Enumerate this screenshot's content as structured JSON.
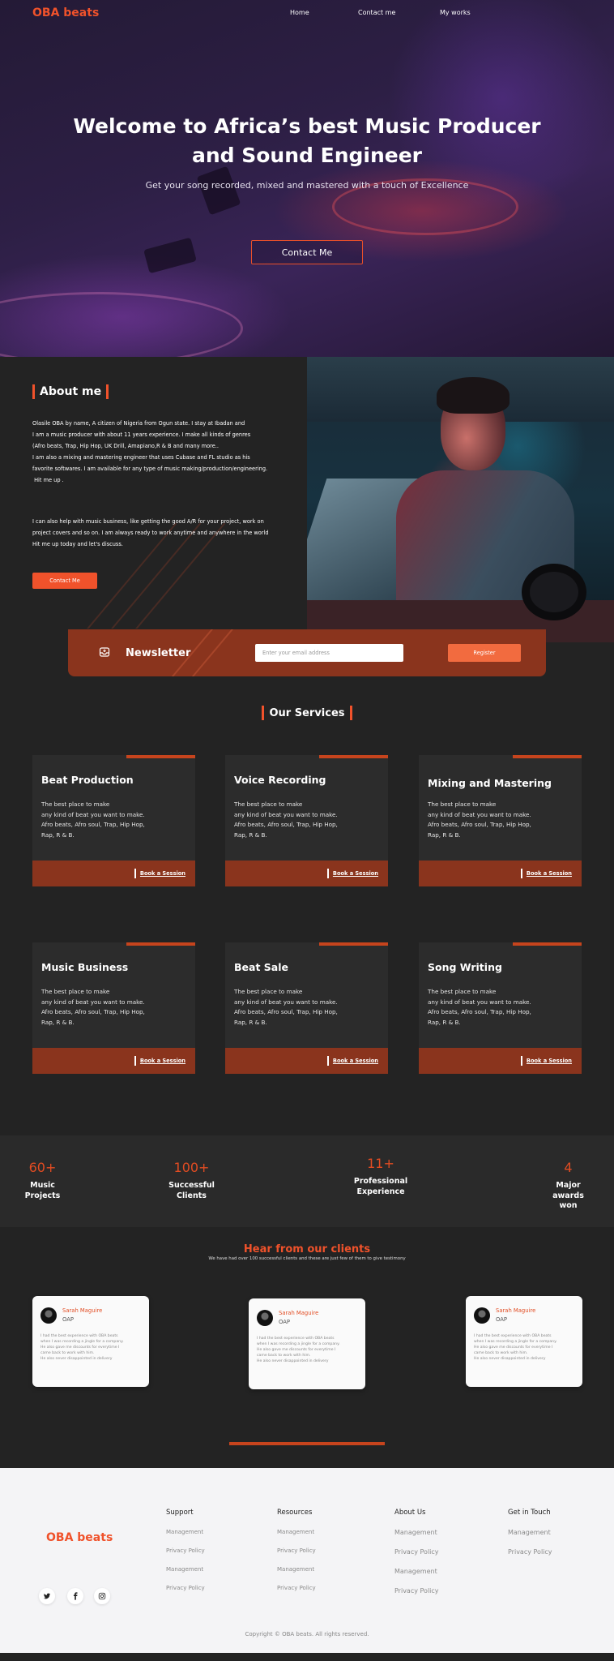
{
  "nav": {
    "logo": "OBA beats",
    "links": [
      "Home",
      "Contact me",
      "My works"
    ]
  },
  "hero": {
    "title_line1": "Welcome to Africa’s best Music Producer",
    "title_line2": "and Sound Engineer",
    "subtitle": "Get your song recorded, mixed and mastered with a touch of Excellence",
    "button": "Contact Me"
  },
  "about": {
    "heading": "About me",
    "para1": [
      "Olasile OBA by name, A citizen of Nigeria from Ogun state. I stay at Ibadan and",
      "I am a music producer with about 11 years experience. I make all kinds of genres",
      "(Afro beats, Trap, Hip Hop, UK Drill, Amapiano,R & B and many more..",
      "I am also a mixing and mastering engineer that uses Cubase and FL studio as his",
      "favorite softwares. I am available for  any type of music making/production/engineering.",
      " Hit me up ."
    ],
    "para2": [
      "I can also help with music business, like getting the good A/R for your project, work on",
      "project covers and so on. I am always ready to work anytime and anywhere in the world",
      "Hit me up today and let's discuss."
    ],
    "button": "Contact Me"
  },
  "newsletter": {
    "title": "Newsletter",
    "email_placeholder": "Enter your email address",
    "email_value": "",
    "button": "Register",
    "icon": "inbox-icon"
  },
  "services": {
    "heading": "Our Services",
    "items": [
      {
        "title": "Beat Production",
        "text": "The best place to make\nany kind of beat you want to make.\nAfro beats, Afro soul, Trap, Hip Hop,\nRap, R & B.",
        "link": "Book a Session"
      },
      {
        "title": "Voice Recording",
        "text": "The best place to make\nany kind of beat you want to make.\nAfro beats, Afro soul, Trap, Hip Hop,\nRap, R & B.",
        "link": "Book a Session"
      },
      {
        "title": "Mixing and Mastering",
        "text": "The best place to make\nany kind of beat you want to make.\nAfro beats, Afro soul, Trap, Hip Hop,\nRap, R & B.",
        "link": "Book a Session"
      },
      {
        "title": "Music Business",
        "text": "The best place to make\nany kind of beat you want to make.\nAfro beats, Afro soul, Trap, Hip Hop,\nRap, R & B.",
        "link": "Book a Session"
      },
      {
        "title": "Beat Sale",
        "text": "The best place to make\nany kind of beat you want to make.\nAfro beats, Afro soul, Trap, Hip Hop,\nRap, R & B.",
        "link": "Book a Session"
      },
      {
        "title": "Song Writing",
        "text": "The best place to make\nany kind of beat you want to make.\nAfro beats, Afro soul, Trap, Hip Hop,\nRap, R & B.",
        "link": "Book a Session"
      }
    ]
  },
  "stats": [
    {
      "number": "60+",
      "label": "Music\nProjects"
    },
    {
      "number": "100+",
      "label": "Successful\nClients"
    },
    {
      "number": "11+",
      "label": "Professional\nExperience"
    },
    {
      "number": "4",
      "label": "Major\nawards\nwon"
    }
  ],
  "testimonials": {
    "title": "Hear from our clients",
    "subtitle": "We have had over 100 successful clients and these are just few of them to give testimony",
    "items": [
      {
        "name": "Sarah Maguire",
        "role": "OAP",
        "text": "I had the best experience with OBA beats\nwhen I was recording a jingle for a company.\nHe also gave me discounts for everytime I\ncame back to work with him.\nHe also never disappointed in delivery"
      },
      {
        "name": "Sarah Maguire",
        "role": "OAP",
        "text": "I had the best experience with OBA beats\nwhen I was recording a jingle for a company.\nHe also gave me discounts for everytime I\ncame back to work with him.\nHe also never disappointed in delivery"
      },
      {
        "name": "Sarah Maguire",
        "role": "OAP",
        "text": "I had the best experience with OBA beats\nwhen I was recording a jingle for a company.\nHe also gave me discounts for everytime I\ncame back to work with him.\nHe also never disappointed in delivery"
      }
    ]
  },
  "footer": {
    "logo": "OBA beats",
    "social": [
      "twitter-icon",
      "facebook-icon",
      "instagram-icon"
    ],
    "columns": [
      {
        "heading": "Support",
        "links": [
          "Management",
          "Privacy Policy",
          "Management",
          "Privacy Policy"
        ]
      },
      {
        "heading": "Resources",
        "links": [
          "Management",
          "Privacy Policy",
          "Management",
          "Privacy Policy"
        ]
      },
      {
        "heading": "About Us",
        "links": [
          "Management",
          "Privacy Policy",
          "Management",
          "Privacy Policy"
        ]
      },
      {
        "heading": "Get in Touch",
        "links": [
          "Management",
          "Privacy Policy"
        ]
      }
    ],
    "copyright": "Copyright © OBA beats. All rights reserved."
  },
  "colors": {
    "accent": "#f0522b",
    "card_footer": "#8a341d",
    "background": "#232323",
    "footer_bg": "#f4f4f6"
  }
}
